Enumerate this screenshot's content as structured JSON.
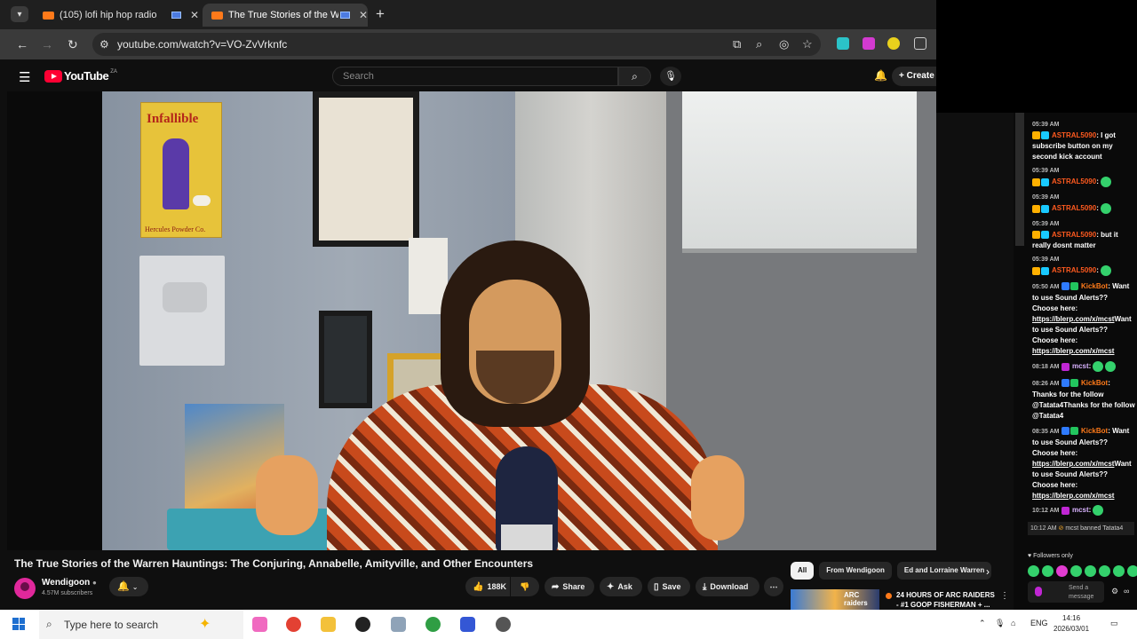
{
  "browser": {
    "tabs": [
      {
        "title": "(105) lofi hip hop radio",
        "active": false
      },
      {
        "title": "The True Stories of the Warr",
        "active": true
      }
    ],
    "url": "youtube.com/watch?v=VO-ZvVrknfc"
  },
  "youtube": {
    "logo": "YouTube",
    "country": "ZA",
    "search_placeholder": "Search",
    "create_label": "Create"
  },
  "video": {
    "title": "The True Stories of the Warren Hauntings: The Conjuring, Annabelle, Amityville, and Other Encounters",
    "channel": "Wendigoon",
    "subscribers": "4.57M subscribers",
    "likes": "188K",
    "share_label": "Share",
    "ask_label": "Ask",
    "save_label": "Save",
    "download_label": "Download",
    "scene": {
      "poster_title": "Infallible",
      "poster_footer": "Hercules Powder Co."
    }
  },
  "chips": [
    "All",
    "From Wendigoon",
    "Ed and Lorraine Warren"
  ],
  "recommendation": {
    "thumb_text": "ARC raiders",
    "title": "24 HOURS OF ARC RAIDERS - #1 GOOP FISHERMAN + ..."
  },
  "chat": {
    "messages": [
      {
        "time": "05:39 AM",
        "user": "ASTRAL5090",
        "text": "I got subscribe button on my second kick account"
      },
      {
        "time": "05:39 AM",
        "user": "ASTRAL5090",
        "text": ""
      },
      {
        "time": "05:39 AM",
        "user": "ASTRAL5090",
        "text": ""
      },
      {
        "time": "05:39 AM",
        "user": "ASTRAL5090",
        "text": "but it really dosnt matter"
      },
      {
        "time": "05:39 AM",
        "user": "ASTRAL5090",
        "text": ""
      },
      {
        "time": "05:50 AM",
        "user": "KickBot",
        "text": "Want to use Sound Alerts?? Choose here:",
        "link1": "https://blerp.com/x/mcst",
        "link1_tail": "Want to use Sound Alerts?? Choose here:",
        "link2": "https://blerp.com/x/mcst"
      },
      {
        "time": "08:18 AM",
        "user": "mcst",
        "text": ""
      },
      {
        "time": "08:26 AM",
        "user": "KickBot",
        "text": "Thanks for the follow @Tatata4Thanks for the follow @Tatata4"
      },
      {
        "time": "08:35 AM",
        "user": "KickBot",
        "text": "Want to use Sound Alerts?? Choose here:",
        "link1": "https://blerp.com/x/mcst",
        "link1_tail": "Want to use Sound Alerts?? Choose here:",
        "link2": "https://blerp.com/x/mcst"
      },
      {
        "time": "10:12 AM",
        "user": "mcst",
        "text": ""
      }
    ],
    "system_message": {
      "time": "10:12 AM",
      "text": "mcst banned Tatata4"
    },
    "followers_only": "Followers only",
    "send_placeholder": "Send a message"
  },
  "taskbar": {
    "search_placeholder": "Type here to search",
    "language": "ENG",
    "time": "14:16",
    "date": "2026/03/01"
  },
  "colors": {
    "youtube_red": "#ff0033",
    "kick_green": "#34d16c",
    "astral_orange": "#ff5a1f"
  }
}
